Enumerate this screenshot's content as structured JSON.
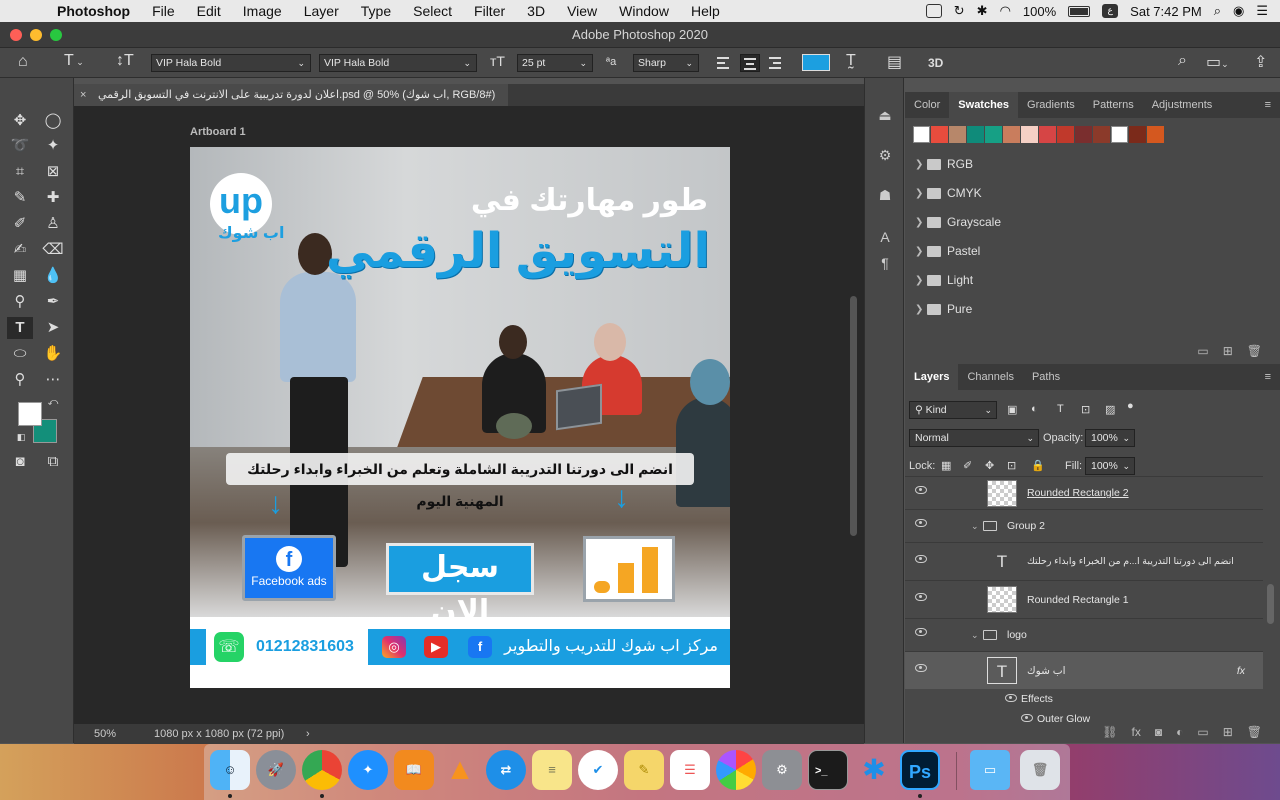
{
  "menubar": {
    "app_name": "Photoshop",
    "items": [
      "File",
      "Edit",
      "Image",
      "Layer",
      "Type",
      "Select",
      "Filter",
      "3D",
      "View",
      "Window",
      "Help"
    ],
    "battery": "100%",
    "clock": "Sat 7:42 PM"
  },
  "window": {
    "title": "Adobe Photoshop 2020"
  },
  "options_bar": {
    "font_family": "VIP Hala Bold",
    "font_style": "VIP Hala Bold",
    "font_size": "25 pt",
    "antialias_label": "ªa",
    "antialias": "Sharp",
    "text_color": "#1c9fe0",
    "threed_label": "3D"
  },
  "document": {
    "tab_title": "اعلان لدورة تدريبية على الانترنت في التسويق الرقمي.psd @ 50% (اب شوك, RGB/8#)",
    "artboard_label": "Artboard 1",
    "zoom": "50%",
    "dimensions": "1080 px x 1080 px (72 ppi)"
  },
  "artwork": {
    "logo_text": "up",
    "logo_sub": "اب شوك",
    "headline_1": "طور مهارتك في",
    "headline_2": "التسويق الرقمي",
    "join_text": "انضم الى دورتنا التدريبة الشاملة وتعلم من الخبراء وابداء رحلتك المهنية اليوم",
    "fb_label": "Facebook ads",
    "signup_button": "سجل الان",
    "phone": "01212831603",
    "center_name": "مركز اب شوك للتدريب والتطوير",
    "accent": "#1a9ee0"
  },
  "swatches_panel": {
    "tabs": [
      "Color",
      "Swatches",
      "Gradients",
      "Patterns",
      "Adjustments"
    ],
    "active_tab": "Swatches",
    "colors": [
      "#ffffff",
      "#e84c3d",
      "#b7876a",
      "#0f8b7a",
      "#16a085",
      "#c97d5d",
      "#f5d0c5",
      "#d64545",
      "#c0392b",
      "#7a2e2e",
      "#8b3a2a",
      "#ffffff",
      "#7b2a1a",
      "#d4581f"
    ],
    "folders": [
      "RGB",
      "CMYK",
      "Grayscale",
      "Pastel",
      "Light",
      "Pure"
    ]
  },
  "layers_panel": {
    "tabs": [
      "Layers",
      "Channels",
      "Paths"
    ],
    "active_tab": "Layers",
    "kind_filter": "Kind",
    "blend_mode": "Normal",
    "opacity_label": "Opacity:",
    "opacity": "100%",
    "lock_label": "Lock:",
    "fill_label": "Fill:",
    "fill": "100%",
    "layers": [
      {
        "name": "Rounded Rectangle 2",
        "type": "shape"
      },
      {
        "name": "Group 2",
        "type": "group"
      },
      {
        "name": "انضم الى دورتنا التدريبة ا...م من الخبراء وابداء رحلتك",
        "type": "text"
      },
      {
        "name": "Rounded Rectangle 1",
        "type": "shape"
      },
      {
        "name": "logo",
        "type": "group"
      },
      {
        "name": "اب شوك",
        "type": "text"
      }
    ],
    "effects_label": "Effects",
    "effect_name": "Outer Glow"
  },
  "dock": {
    "ps_label": "Ps"
  }
}
